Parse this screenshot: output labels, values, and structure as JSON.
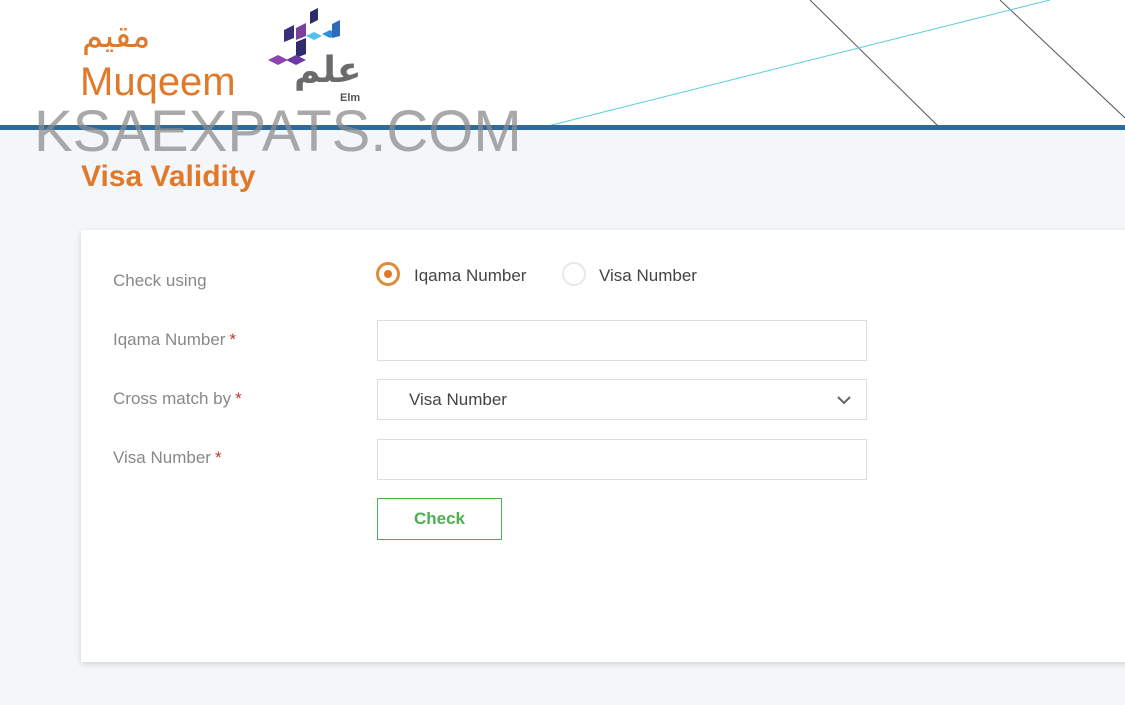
{
  "header": {
    "logo_arabic": "مقيم",
    "logo_english": "Muqeem",
    "elm_arabic": "علم",
    "elm_english": "Elm",
    "watermark": "KSAEXPATS.COM",
    "colors": {
      "brand": "#e07a2a",
      "bar": "#2f6a9a"
    }
  },
  "page": {
    "title": "Visa Validity"
  },
  "form": {
    "check_using_label": "Check using",
    "radio_options": [
      {
        "label": "Iqama Number",
        "selected": true
      },
      {
        "label": "Visa Number",
        "selected": false
      }
    ],
    "iqama_label": "Iqama Number",
    "iqama_value": "",
    "cross_match_label": "Cross match by",
    "cross_match_value": "Visa Number",
    "visa_label": "Visa Number",
    "visa_value": "",
    "required_mark": "*",
    "check_button": "Check",
    "colors": {
      "button": "#4caf50",
      "required": "#c0392b"
    }
  }
}
